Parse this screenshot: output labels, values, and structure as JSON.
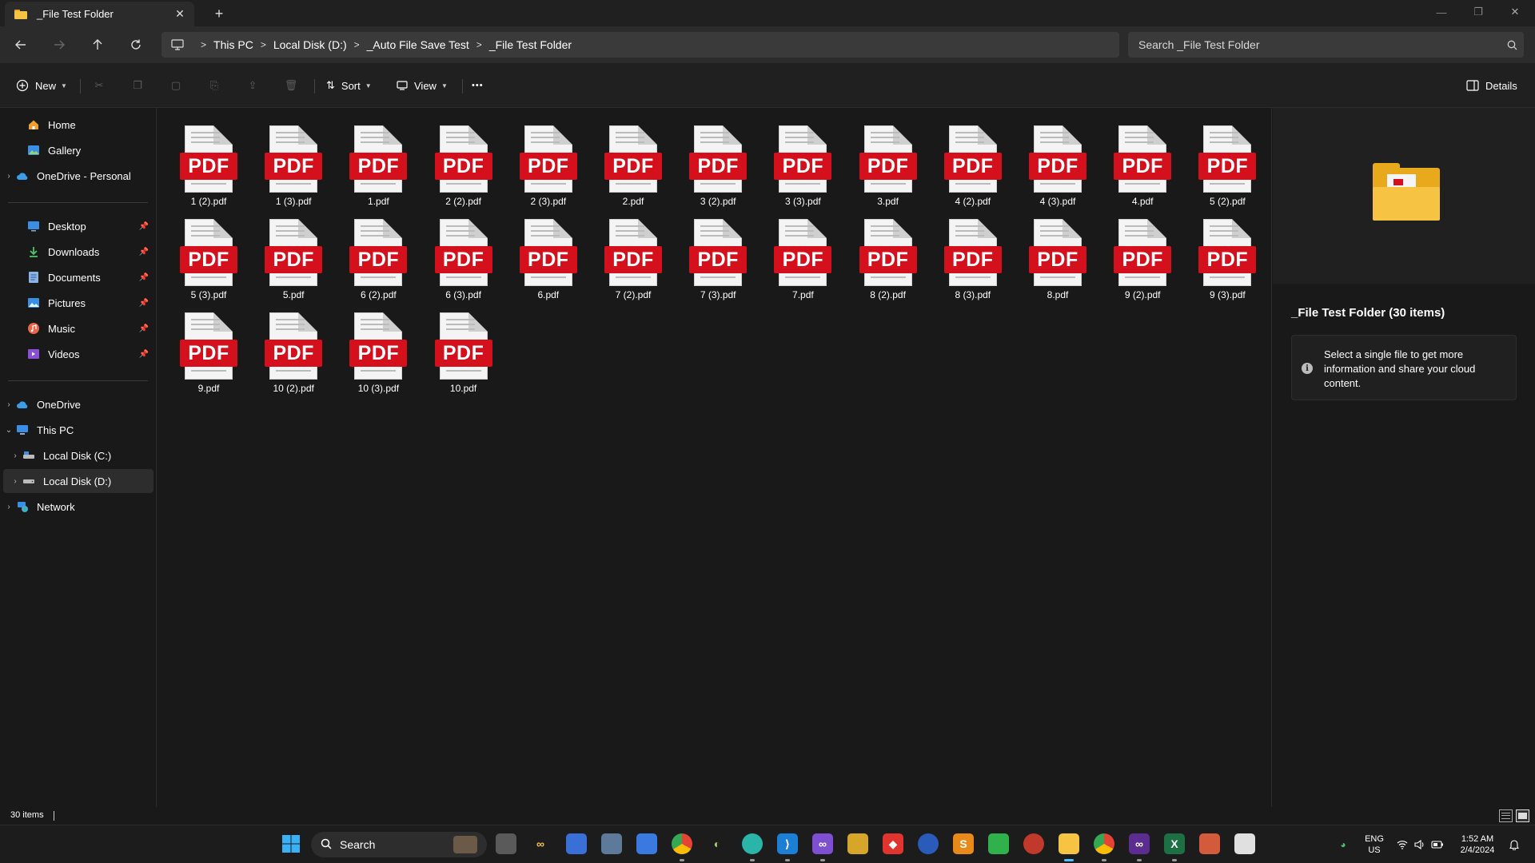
{
  "window": {
    "tab_title": "_File Test Folder",
    "tab_close": "✕",
    "new_tab": "+",
    "minimize": "—",
    "maximize": "❐",
    "close": "✕"
  },
  "address": {
    "crumbs": [
      "This PC",
      "Local Disk (D:)",
      "_Auto File Save Test",
      "_File Test Folder"
    ],
    "search_placeholder": "Search _File Test Folder"
  },
  "commands": {
    "new": "New",
    "sort": "Sort",
    "view": "View",
    "more": "•••",
    "details": "Details"
  },
  "sidebar": {
    "items": [
      {
        "label": "Home",
        "icon": "home-icon"
      },
      {
        "label": "Gallery",
        "icon": "gallery-icon"
      },
      {
        "label": "OneDrive - Personal",
        "icon": "cloud-icon"
      },
      {
        "label": "Desktop",
        "icon": "desktop-icon"
      },
      {
        "label": "Downloads",
        "icon": "download-icon"
      },
      {
        "label": "Documents",
        "icon": "documents-icon"
      },
      {
        "label": "Pictures",
        "icon": "pictures-icon"
      },
      {
        "label": "Music",
        "icon": "music-icon"
      },
      {
        "label": "Videos",
        "icon": "videos-icon"
      },
      {
        "label": "OneDrive",
        "icon": "cloud-icon"
      },
      {
        "label": "This PC",
        "icon": "computer-icon"
      },
      {
        "label": "Local Disk (C:)",
        "icon": "drive-icon"
      },
      {
        "label": "Local Disk (D:)",
        "icon": "drive-icon"
      },
      {
        "label": "Network",
        "icon": "network-icon"
      }
    ]
  },
  "files": [
    "1 (2).pdf",
    "1 (3).pdf",
    "1.pdf",
    "2 (2).pdf",
    "2 (3).pdf",
    "2.pdf",
    "3 (2).pdf",
    "3 (3).pdf",
    "3.pdf",
    "4 (2).pdf",
    "4 (3).pdf",
    "4.pdf",
    "5 (2).pdf",
    "5 (3).pdf",
    "5.pdf",
    "6 (2).pdf",
    "6 (3).pdf",
    "6.pdf",
    "7 (2).pdf",
    "7 (3).pdf",
    "7.pdf",
    "8 (2).pdf",
    "8 (3).pdf",
    "8.pdf",
    "9 (2).pdf",
    "9 (3).pdf",
    "9.pdf",
    "10 (2).pdf",
    "10 (3).pdf",
    "10.pdf"
  ],
  "pdf_badge": "PDF",
  "details": {
    "title": "_File Test Folder (30 items)",
    "info_icon": "i",
    "info": "Select a single file to get more information and share your cloud content."
  },
  "status": {
    "count": "30 items"
  },
  "taskbar": {
    "search": "Search",
    "lang_line1": "ENG",
    "lang_line2": "US",
    "time": "1:52 AM",
    "date": "2/4/2024"
  },
  "colors": {
    "accent": "#4cc2ff",
    "pdf_red": "#d3101b",
    "folder": "#e8a91c"
  }
}
